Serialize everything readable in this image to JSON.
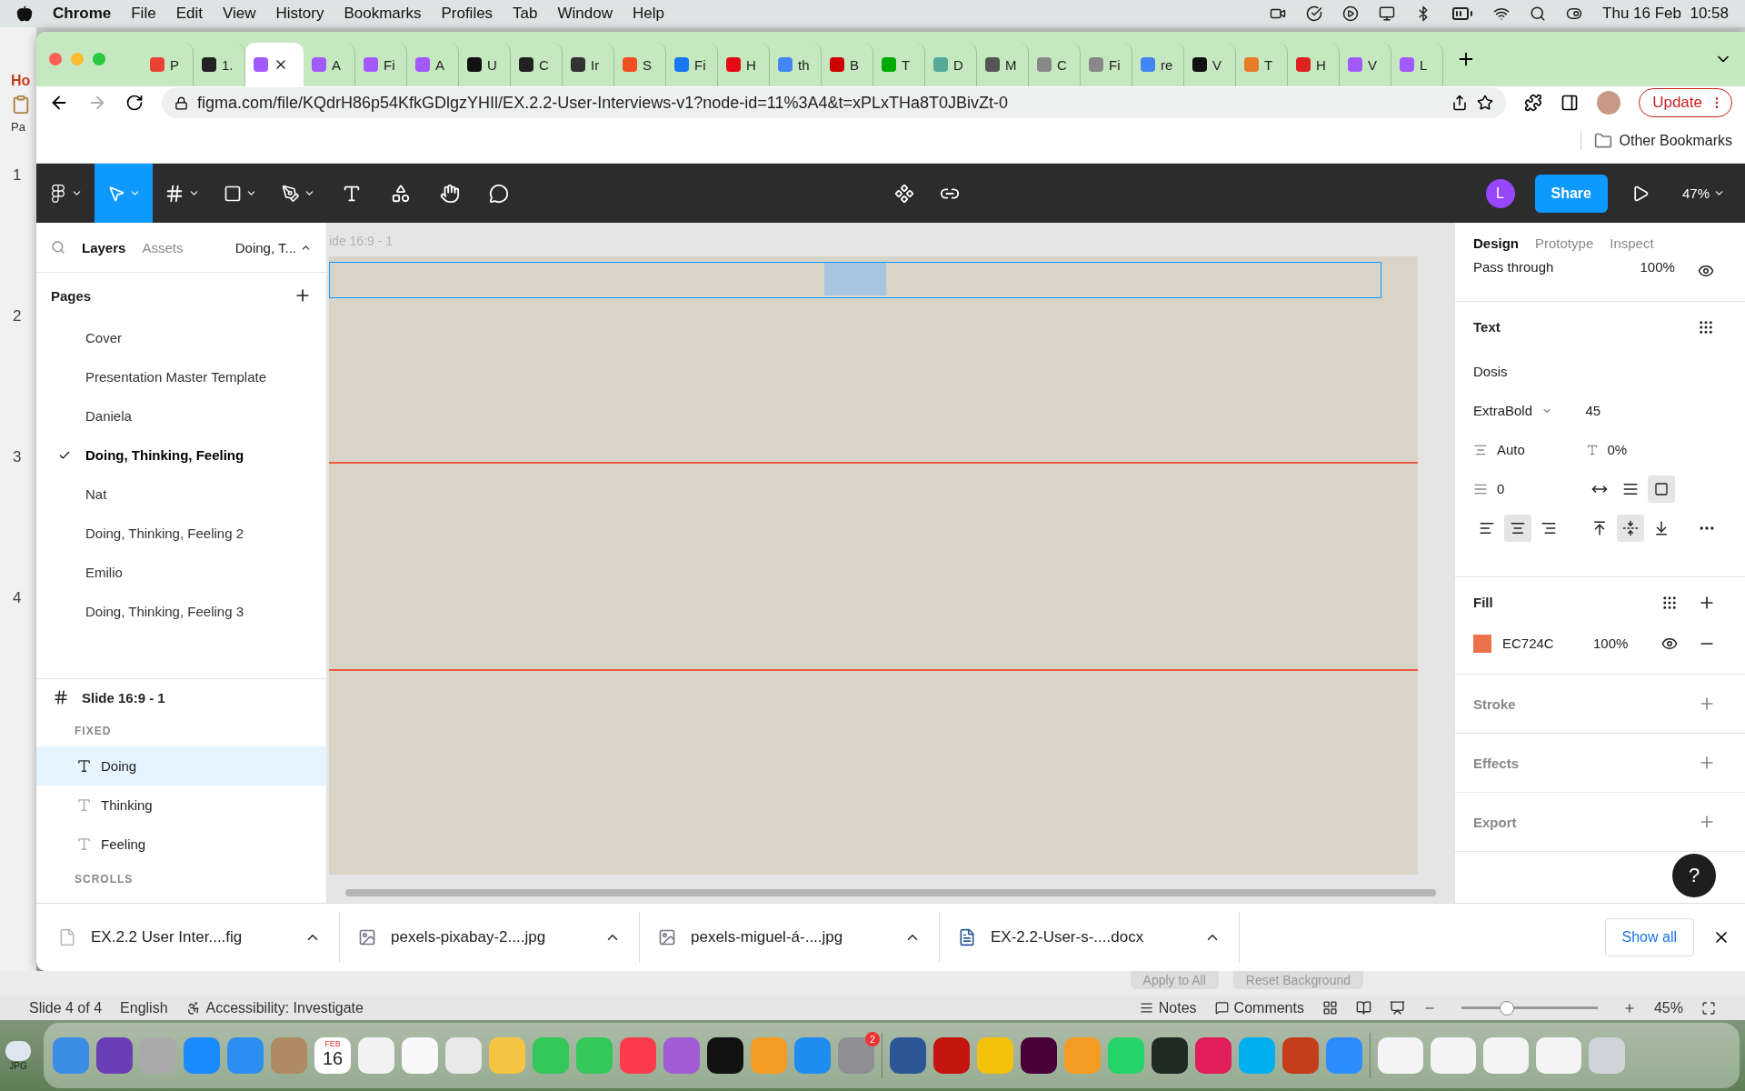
{
  "menubar": {
    "app": "Chrome",
    "menus": [
      "File",
      "Edit",
      "View",
      "History",
      "Bookmarks",
      "Profiles",
      "Tab",
      "Window",
      "Help"
    ],
    "clock": "Thu 16 Feb  10:58"
  },
  "background_app": {
    "ribbon_tab": "Ho",
    "ribbon_button": "Pa",
    "slide_numbers": [
      "1",
      "2",
      "3",
      "4"
    ],
    "buttons": [
      "Apply to All",
      "Reset Background"
    ],
    "status_bar": {
      "slide": "Slide 4 of 4",
      "language": "English",
      "accessibility": "Accessibility: Investigate",
      "notes": "Notes",
      "comments": "Comments",
      "level": 0.35,
      "zoom": "45%"
    }
  },
  "browser": {
    "tabs": [
      {
        "label": "P",
        "selected": false
      },
      {
        "label": "1.",
        "selected": false
      },
      {
        "selected": true
      },
      {
        "label": "A",
        "selected": false
      },
      {
        "label": "Fi",
        "selected": false
      },
      {
        "label": "A",
        "selected": false
      },
      {
        "label": "U",
        "selected": false
      },
      {
        "label": "C",
        "selected": false
      },
      {
        "label": "Ir",
        "selected": false
      },
      {
        "label": "S",
        "selected": false
      },
      {
        "label": "Fi",
        "selected": false
      },
      {
        "label": "H",
        "selected": false
      },
      {
        "label": "th",
        "selected": false
      },
      {
        "label": "B",
        "selected": false
      },
      {
        "label": "T",
        "selected": false
      },
      {
        "label": "D",
        "selected": false
      },
      {
        "label": "M",
        "selected": false
      },
      {
        "label": "C",
        "selected": false
      },
      {
        "label": "Fi",
        "selected": false
      },
      {
        "label": "re",
        "selected": false
      },
      {
        "label": "V",
        "selected": false
      },
      {
        "label": "T",
        "selected": false
      },
      {
        "label": "H",
        "selected": false
      },
      {
        "label": "V",
        "selected": false
      },
      {
        "label": "L",
        "selected": false
      }
    ],
    "url": "figma.com/file/KQdrH86p54KfkGDlgzYHIl/EX.2.2-User-Interviews-v1?node-id=11%3A4&t=xPLxTHa8T0JBivZt-0",
    "update_button": "Update",
    "other_bookmarks": "Other Bookmarks"
  },
  "figma": {
    "toolbar": {
      "tools": [
        {
          "kind": "main-menu",
          "selected": false
        },
        {
          "kind": "move",
          "selected": true
        },
        {
          "kind": "frame",
          "selected": false
        },
        {
          "kind": "shape",
          "selected": false
        },
        {
          "kind": "pen",
          "selected": false
        },
        {
          "kind": "text",
          "selected": false
        },
        {
          "kind": "resources",
          "selected": false
        },
        {
          "kind": "hand",
          "selected": false
        },
        {
          "kind": "comment",
          "selected": false
        }
      ],
      "avatar": "L",
      "share": "Share",
      "zoom": "47%"
    },
    "left_panel": {
      "tabs": [
        {
          "label": "Layers",
          "selected": true
        },
        {
          "label": "Assets",
          "selected": false
        }
      ],
      "page_menu": "Doing, T...",
      "pages_title": "Pages",
      "pages": [
        {
          "name": "Cover",
          "selected": false
        },
        {
          "name": "Presentation Master Template",
          "selected": false
        },
        {
          "name": "Daniela",
          "selected": false
        },
        {
          "name": "Doing, Thinking, Feeling",
          "selected": true
        },
        {
          "name": "Nat",
          "selected": false
        },
        {
          "name": "Doing, Thinking, Feeling 2",
          "selected": false
        },
        {
          "name": "Emilio",
          "selected": false
        },
        {
          "name": "Doing, Thinking, Feeling 3",
          "selected": false
        }
      ],
      "frame": "Slide 16:9 - 1",
      "fixed_title": "FIXED",
      "layers": [
        {
          "name": "Doing",
          "selected": true
        },
        {
          "name": "Thinking",
          "selected": false
        },
        {
          "name": "Feeling",
          "selected": false
        }
      ],
      "scrolls_title": "SCROLLS"
    },
    "canvas": {
      "frame_label": "ide 16:9 - 1"
    },
    "right_panel": {
      "tabs": [
        {
          "label": "Design",
          "selected": true
        },
        {
          "label": "Prototype",
          "selected": false
        },
        {
          "label": "Inspect",
          "selected": false
        }
      ],
      "layer": {
        "blend": "Pass through",
        "opacity": "100%"
      },
      "text": {
        "title": "Text",
        "font": "Dosis",
        "weight": "ExtraBold",
        "size": "45",
        "line_height": "Auto",
        "letter_spacing": "0%",
        "paragraph_spacing": "0",
        "resize": [
          {
            "kind": "auto-width",
            "selected": false
          },
          {
            "kind": "auto-height",
            "selected": false
          },
          {
            "kind": "fixed",
            "selected": true
          }
        ],
        "align": [
          {
            "kind": "left",
            "selected": false
          },
          {
            "kind": "center",
            "selected": true
          },
          {
            "kind": "right",
            "selected": false
          }
        ],
        "valign": [
          {
            "kind": "top",
            "selected": false
          },
          {
            "kind": "middle",
            "selected": true
          },
          {
            "kind": "bottom",
            "selected": false
          }
        ]
      },
      "fill": {
        "title": "Fill",
        "color": "#ec724c",
        "hex": "EC724C",
        "opacity": "100%"
      },
      "sections": [
        "Stroke",
        "Effects",
        "Export"
      ],
      "help": "?"
    }
  },
  "downloads": {
    "items": [
      {
        "name": "EX.2.2 User Inter....fig",
        "kind": "fig"
      },
      {
        "name": "pexels-pixabay-2....jpg",
        "kind": "image"
      },
      {
        "name": "pexels-miguel-á-....jpg",
        "kind": "image"
      },
      {
        "name": "EX-2.2-User-s-....docx",
        "kind": "word"
      }
    ],
    "show_all": "Show all"
  },
  "dock": {
    "calendar_month": "FEB",
    "calendar_day": "16",
    "badge": "2",
    "desktop_file": "JPG"
  }
}
